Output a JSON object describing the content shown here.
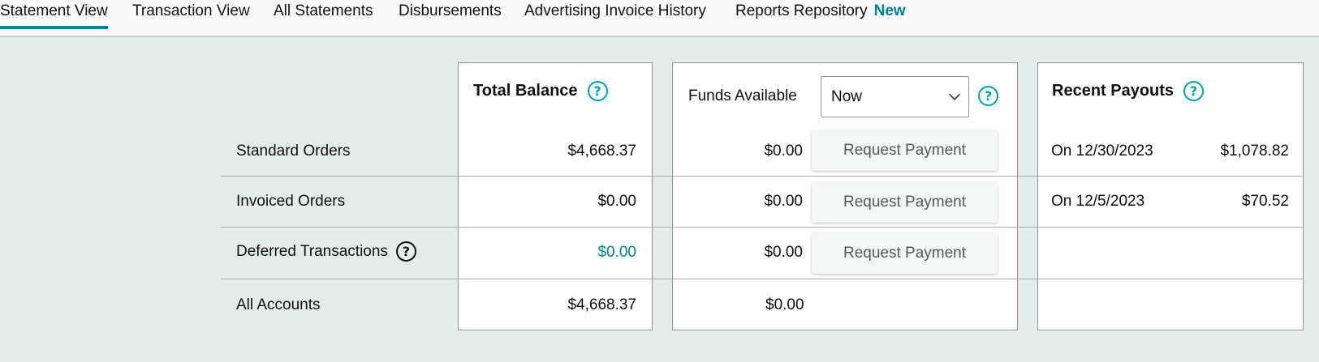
{
  "tabs": [
    {
      "label": "Statement View"
    },
    {
      "label": "Transaction View"
    },
    {
      "label": "All Statements"
    },
    {
      "label": "Disbursements"
    },
    {
      "label": "Advertising Invoice History"
    },
    {
      "label": "Reports Repository",
      "badge": "New"
    }
  ],
  "rows": [
    {
      "label": "Standard Orders",
      "total": "$4,668.37",
      "funds": "$0.00",
      "button": "Request Payment",
      "payout_date": "On 12/30/2023",
      "payout_amount": "$1,078.82"
    },
    {
      "label": "Invoiced Orders",
      "total": "$0.00",
      "funds": "$0.00",
      "button": "Request Payment",
      "payout_date": "On 12/5/2023",
      "payout_amount": "$70.52"
    },
    {
      "label": "Deferred Transactions",
      "total": "$0.00",
      "funds": "$0.00",
      "button": "Request Payment"
    },
    {
      "label": "All Accounts",
      "total": "$4,668.37",
      "funds": "$0.00"
    }
  ],
  "total_balance": {
    "title": "Total Balance"
  },
  "funds_available": {
    "label": "Funds Available",
    "selected": "Now"
  },
  "recent_payouts": {
    "title": "Recent Payouts"
  },
  "help_icon_glyph": "?",
  "colors": {
    "accent": "#008296",
    "help_icon": "#00a3b4",
    "background": "#e3ebeb"
  }
}
